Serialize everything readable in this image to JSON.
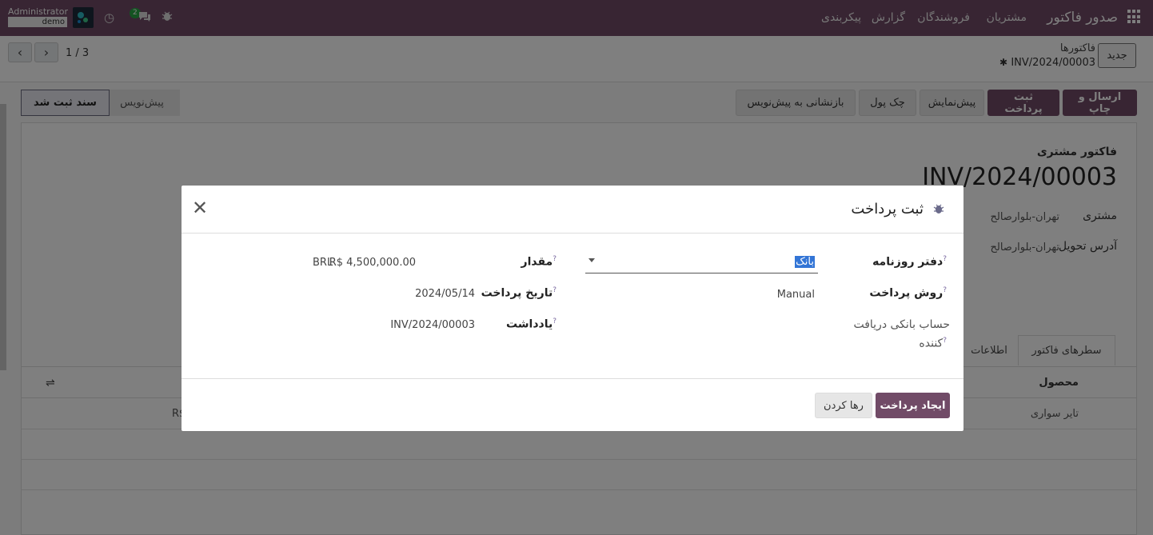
{
  "navbar": {
    "brand": "صدور فاکتور",
    "menu": [
      "مشتریان",
      "فروشندگان",
      "گزارش",
      "پیکربندی"
    ],
    "user_name": "Administrator",
    "db_name": "demo",
    "chat_count": "2",
    "icons": [
      "apps-grid-icon",
      "bug-icon",
      "chat-icon",
      "clock-icon"
    ]
  },
  "control_panel": {
    "new_label": "جدید",
    "breadcrumb_parent": "فاکتورها",
    "breadcrumb_current": "INV/2024/00003",
    "pager_value": "1 / 3"
  },
  "statusbar": {
    "buttons": [
      "ارسال و چاپ",
      "ثبت پرداخت",
      "پیش‌نمایش",
      "چک پول",
      "بازنشانی به پیش‌نویس"
    ],
    "stages": {
      "draft": "پیش‌نویس",
      "posted": "سند ثبت شد"
    }
  },
  "form": {
    "type": "فاکتور مشتری",
    "name": "INV/2024/00003",
    "customer_label": "مشتری",
    "customer_value": "تهران-بلوارصالح",
    "delivery_label": "آدرس تحویل",
    "delivery_value": "تهران-بلوارصالح",
    "tabs": [
      "سطرهای فاکتور",
      "اطلاعات"
    ],
    "table": {
      "col_product": "محصول",
      "row_product": "تایر سواری",
      "row_partial_amount": "R$"
    }
  },
  "modal": {
    "title": "ثبت پرداخت",
    "fields": {
      "journal_label": "دفتر روزنامه",
      "journal_value": "بانک",
      "method_label": "روش پرداخت",
      "method_value": "Manual",
      "bank_label_line1": "حساب بانکی دریافت",
      "bank_label_line2": "کننده",
      "amount_label": "مقدار",
      "amount_value": "R$ 4,500,000.00",
      "currency": "BRL",
      "date_label": "تاریخ پرداخت",
      "date_value": "2024/05/14",
      "memo_label": "یادداشت",
      "memo_value": "INV/2024/00003",
      "help_mark": "?"
    },
    "buttons": {
      "create": "ایجاد پرداخت",
      "discard": "رها کردن"
    }
  },
  "colors": {
    "brand": "#714B67",
    "selection": "#3375d6"
  }
}
